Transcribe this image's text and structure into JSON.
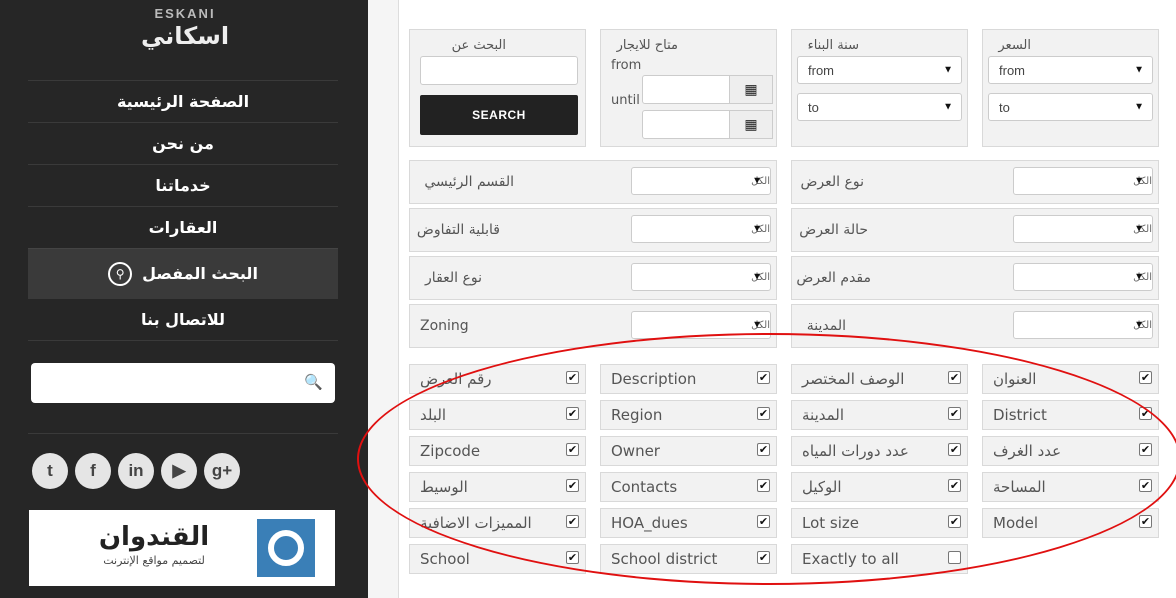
{
  "logo": {
    "latin": "ESKANI",
    "arabic": "اسكاني"
  },
  "nav": {
    "items": [
      {
        "label": "الصفحة الرئيسية"
      },
      {
        "label": "من نحن"
      },
      {
        "label": "خدماتنا"
      },
      {
        "label": "العقارات"
      },
      {
        "label": "البحث المفصل",
        "icon": "search-icon"
      },
      {
        "label": "للاتصال بنا"
      }
    ]
  },
  "sidebar_search": {
    "icon": "search-icon"
  },
  "social": [
    "twitter",
    "facebook",
    "linkedin",
    "youtube",
    "google-plus"
  ],
  "banner": {
    "title": "القندوان",
    "subtitle": "لتصميم مواقع الإنترنت"
  },
  "search_panel": {
    "keyword_label": "البحث عن",
    "search_button": "SEARCH",
    "availability_label": "متاح للايجار",
    "from_label": "from",
    "until_label": "until",
    "year_built_label": "سنة البناء",
    "price_label": "السعر",
    "from_option": "from",
    "to_option": "to"
  },
  "filters": [
    {
      "label": "القسم الرئيسي",
      "value": "الكل"
    },
    {
      "label": "نوع العرض",
      "value": "الكل"
    },
    {
      "label": "قابلية التفاوض",
      "value": "الكل"
    },
    {
      "label": "حالة العرض",
      "value": "الكل"
    },
    {
      "label": "نوع العقار",
      "value": "الكل"
    },
    {
      "label": "مقدم العرض",
      "value": "الكل"
    },
    {
      "label": "Zoning",
      "value": "الكل"
    },
    {
      "label": "المدينة",
      "value": "الكل"
    }
  ],
  "checkboxes": {
    "col1": [
      {
        "label": "رقم العرض",
        "checked": true
      },
      {
        "label": "البلد",
        "checked": true
      },
      {
        "label": "Zipcode",
        "checked": true
      },
      {
        "label": "الوسيط",
        "checked": true
      },
      {
        "label": "المميزات الاضافية",
        "checked": true
      },
      {
        "label": "School",
        "checked": true
      }
    ],
    "col2": [
      {
        "label": "Description",
        "checked": true
      },
      {
        "label": "Region",
        "checked": true
      },
      {
        "label": "Owner",
        "checked": true
      },
      {
        "label": "Contacts",
        "checked": true
      },
      {
        "label": "HOA_dues",
        "checked": true
      },
      {
        "label": "School district",
        "checked": true
      }
    ],
    "col3": [
      {
        "label": "الوصف المختصر",
        "checked": true
      },
      {
        "label": "المدينة",
        "checked": true
      },
      {
        "label": "عدد دورات المياه",
        "checked": true
      },
      {
        "label": "الوكيل",
        "checked": true
      },
      {
        "label": "Lot size",
        "checked": true
      },
      {
        "label": "Exactly to all",
        "checked": false
      }
    ],
    "col4": [
      {
        "label": "العنوان",
        "checked": true
      },
      {
        "label": "District",
        "checked": true
      },
      {
        "label": "عدد الغرف",
        "checked": true
      },
      {
        "label": "المساحة",
        "checked": true
      },
      {
        "label": "Model",
        "checked": true
      }
    ]
  },
  "colors": {
    "sidebar": "#262626",
    "highlight_oval": "#e01010",
    "banner_logo": "#3a7fb7"
  }
}
